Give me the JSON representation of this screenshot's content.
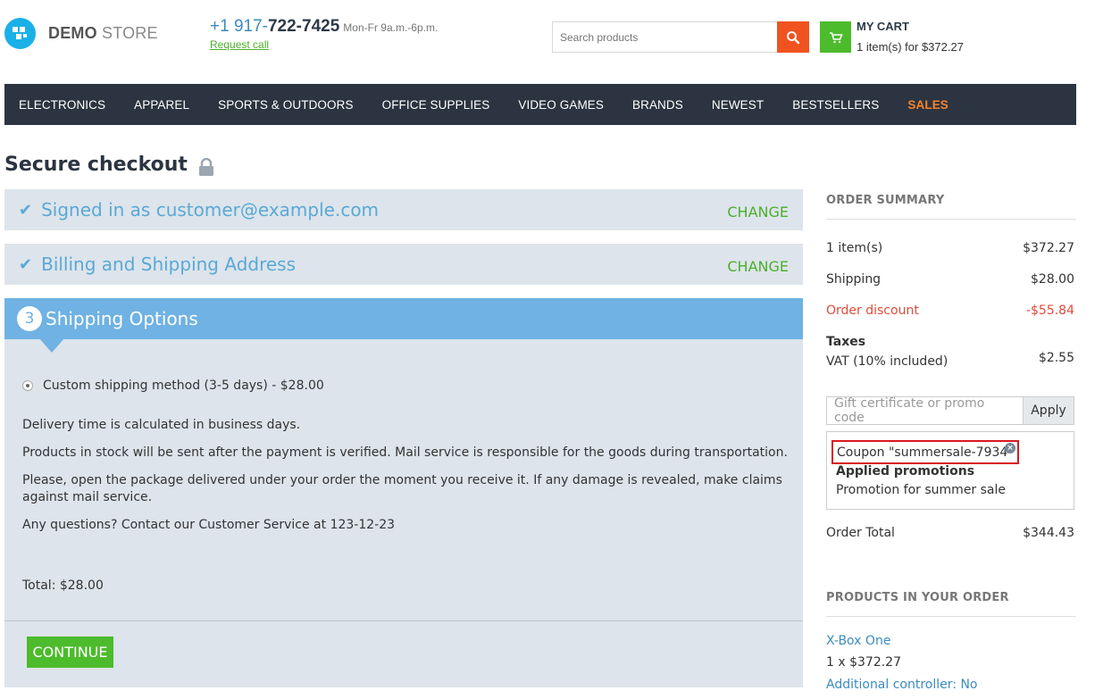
{
  "header": {
    "logo_bold": "DEMO",
    "logo_light": " STORE",
    "phone_prefix": "+1 917-",
    "phone_main": "722-7425",
    "phone_hours": "Mon-Fr 9a.m.-6p.m.",
    "request_call": "Request call",
    "search_placeholder": "Search products",
    "cart_title": "MY CART",
    "cart_summary": "1 item(s) for $372.27"
  },
  "nav": {
    "items": [
      "ELECTRONICS",
      "APPAREL",
      "SPORTS & OUTDOORS",
      "OFFICE SUPPLIES",
      "VIDEO GAMES",
      "BRANDS",
      "NEWEST",
      "BESTSELLERS"
    ],
    "sales": "SALES",
    "colors": {
      "bar": "#2b3440",
      "sales": "#f7822b"
    }
  },
  "checkout": {
    "title": "Secure checkout",
    "step1": {
      "title": "Signed in as customer@example.com",
      "change": "CHANGE"
    },
    "step2": {
      "title": "Billing and Shipping Address",
      "change": "CHANGE"
    },
    "step3": {
      "number": "3",
      "title": "Shipping Options",
      "method": "Custom shipping method (3-5 days) - $28.00",
      "paragraphs": [
        "Delivery time is calculated in business days.",
        "Products in stock will be sent after the payment is verified. Mail service is responsible for the goods during transportation.",
        "Please, open the package delivered under your order the moment you receive it. If any damage is revealed, make claims against mail service.",
        "Any questions? Contact our Customer Service at 123-12-23"
      ],
      "total": "Total: $28.00",
      "continue": "CONTINUE"
    }
  },
  "summary": {
    "heading": "ORDER SUMMARY",
    "items_label": "1 item(s)",
    "items_value": "$372.27",
    "shipping_label": "Shipping",
    "shipping_value": "$28.00",
    "discount_label": "Order discount",
    "discount_value": "-$55.84",
    "taxes_label": "Taxes",
    "vat_label": "VAT (10% included)",
    "vat_value": "$2.55",
    "promo_placeholder": "Gift certificate or promo code",
    "apply": "Apply",
    "coupon": "Coupon \"summersale-7934\"",
    "applied_heading": "Applied promotions",
    "promotion": "Promotion for summer sale",
    "total_label": "Order Total",
    "total_value": "$344.43"
  },
  "products": {
    "heading": "PRODUCTS IN YOUR ORDER",
    "name": "X-Box One",
    "qty": "1 x $372.27",
    "option": "Additional controller: No"
  }
}
